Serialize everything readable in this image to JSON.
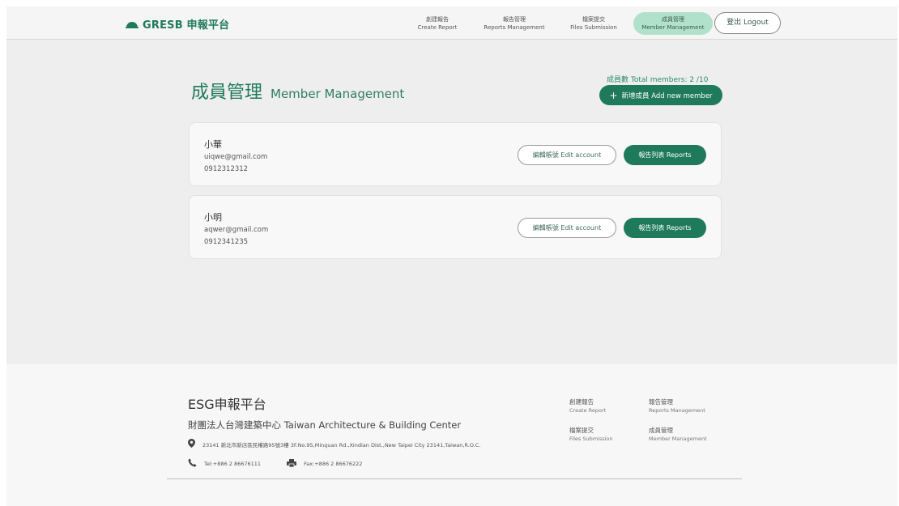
{
  "colors": {
    "brand": "#1f7a5c",
    "nav_active": "#b2e1cb"
  },
  "header": {
    "brand": "GRESB 申報平台",
    "logo_icon": "dome-icon",
    "nav": [
      {
        "zh": "創建報告",
        "en": "Create Report"
      },
      {
        "zh": "報告管理",
        "en": "Reports Management"
      },
      {
        "zh": "檔案提交",
        "en": "Files Submission"
      },
      {
        "zh": "成員管理",
        "en": "Member Management"
      }
    ],
    "logout": "登出 Logout"
  },
  "main": {
    "title_zh": "成員管理",
    "title_en": "Member Management",
    "member_count": "成員數 Total members: 2 /10",
    "add_button": "新增成員 Add new member",
    "members": [
      {
        "name": "小華",
        "email": "uiqwe@gmail.com",
        "phone": "0912312312",
        "edit": "編輯帳號 Edit account",
        "reports": "報告列表 Reports"
      },
      {
        "name": "小明",
        "email": "aqwer@gmail.com",
        "phone": "0912341235",
        "edit": "編輯帳號 Edit account",
        "reports": "報告列表 Reports"
      }
    ]
  },
  "footer": {
    "title": "ESG申報平台",
    "org": "財團法人台灣建築中心 Taiwan Architecture & Building Center",
    "address": "23141 新北市新店區民權路95號3樓 3F.No.95,Minquan Rd.,Xindian Dist.,New Taipei City 23141,Taiwan,R.O.C.",
    "tel": "Tel:+886 2 86676111",
    "fax": "Fax:+886 2 86676222",
    "links": [
      {
        "zh": "創建報告",
        "en": "Create Report"
      },
      {
        "zh": "報告管理",
        "en": "Reports Management"
      },
      {
        "zh": "檔案提交",
        "en": "Files Submission"
      },
      {
        "zh": "成員管理",
        "en": "Member Management"
      }
    ]
  }
}
